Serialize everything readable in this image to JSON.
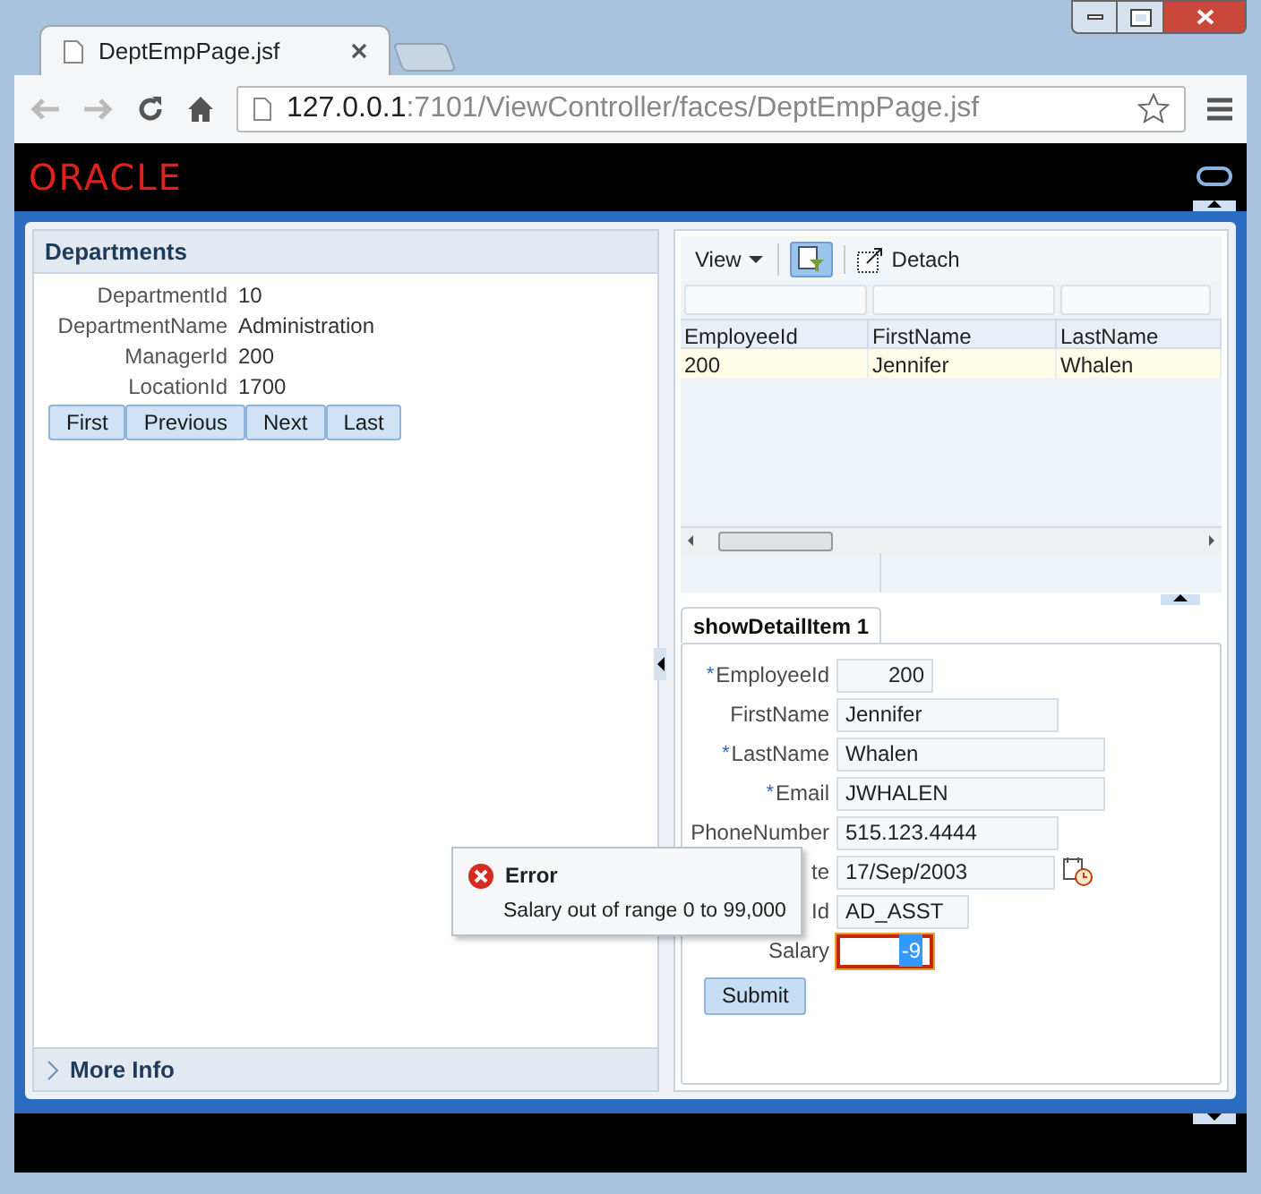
{
  "browser": {
    "tab_title": "DeptEmpPage.jsf",
    "address_host": "127.0.0.1",
    "address_path": ":7101/ViewController/faces/DeptEmpPage.jsf"
  },
  "brand": "ORACLE",
  "departments": {
    "title": "Departments",
    "fields": [
      {
        "label": "DepartmentId",
        "value": "10"
      },
      {
        "label": "DepartmentName",
        "value": "Administration"
      },
      {
        "label": "ManagerId",
        "value": "200"
      },
      {
        "label": "LocationId",
        "value": "1700"
      }
    ],
    "buttons": [
      "First",
      "Previous",
      "Next",
      "Last"
    ]
  },
  "more_info": {
    "label": "More Info",
    "expanded": false
  },
  "employees": {
    "view_menu": "View",
    "filter_on": true,
    "detach": "Detach",
    "columns": [
      "EmployeeId",
      "FirstName",
      "LastName"
    ],
    "rows": [
      {
        "cells": [
          "200",
          "Jennifer",
          "Whalen"
        ],
        "selected": true
      }
    ]
  },
  "detail_tab": {
    "label": "showDetailItem 1",
    "selected": true
  },
  "form": {
    "required_mark": "*",
    "fields": [
      {
        "label": "EmployeeId",
        "value": "200",
        "required": true,
        "kind": "number"
      },
      {
        "label": "FirstName",
        "value": "Jennifer",
        "required": false,
        "kind": "text"
      },
      {
        "label": "LastName",
        "value": "Whalen",
        "required": true,
        "kind": "text"
      },
      {
        "label": "Email",
        "value": "JWHALEN",
        "required": true,
        "kind": "text"
      },
      {
        "label": "PhoneNumber",
        "value": "515.123.4444",
        "required": false,
        "kind": "text"
      },
      {
        "label": "te",
        "value": "17/Sep/2003",
        "required": false,
        "kind": "date"
      },
      {
        "label": "Id",
        "value": "AD_ASST",
        "required": false,
        "kind": "text"
      },
      {
        "label": "Salary",
        "value": "-9",
        "required": false,
        "kind": "number",
        "error": true
      }
    ]
  },
  "submit": "Submit",
  "error_popup": {
    "title": "Error",
    "message": "Salary out of range 0 to 99,000"
  }
}
